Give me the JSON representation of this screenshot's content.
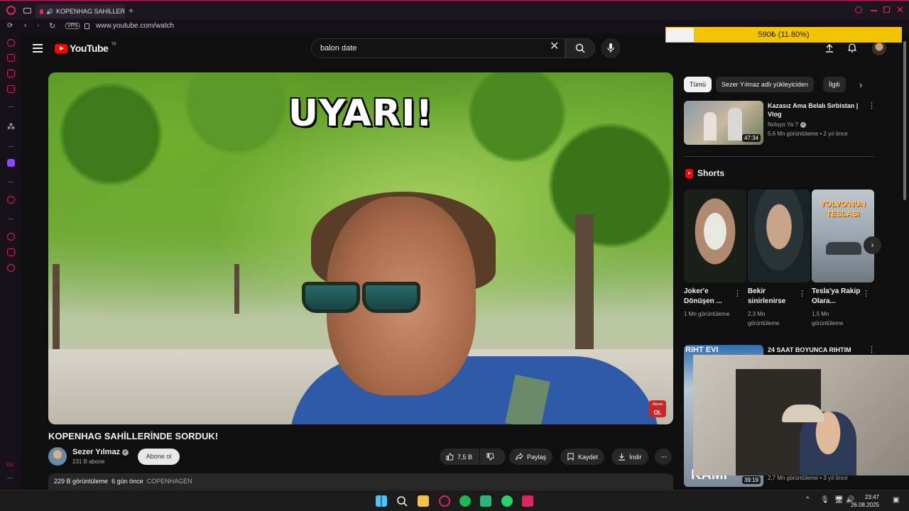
{
  "browser": {
    "tab_title": "KOPENHAG SAHİLLER",
    "vpn_label": "VPN",
    "url": "www.youtube.com/watch"
  },
  "header": {
    "logo_text": "YouTube",
    "logo_region": "TR",
    "search_value": "balon date"
  },
  "donation": {
    "label": "590₺ (11.80%)",
    "progress_percent": 11.8
  },
  "video": {
    "overlay_text": "UYARI!",
    "subscribe_badge_line1": "Abone",
    "subscribe_badge_line2": "OL",
    "title": "KOPENHAG SAHİLLERİNDE SORDUK!",
    "channel_name": "Sezer Yılmaz",
    "subscribers": "231 B abone",
    "subscribe_label": "Abone ol",
    "likes": "7,5 B",
    "share_label": "Paylaş",
    "save_label": "Kaydet",
    "download_label": "İndir",
    "description_views": "229 B görüntüleme",
    "description_date": "6 gün önce",
    "description_tag": "COPENHAGEN"
  },
  "chips": [
    {
      "label": "Tümü"
    },
    {
      "label": "Sezer Yılmaz adlı yükleyiciden"
    },
    {
      "label": "İlgili"
    }
  ],
  "recommendations": [
    {
      "title": "Kazasız Ama Belalı Sırbistan | Vlog",
      "channel": "Noluyo Ya ?",
      "meta": "5,6 Mn görüntüleme • 2 yıl önce",
      "duration": "47:34"
    },
    {
      "title": "24 SAAT BOYUNCA RIHTIM",
      "thumb_text": "RIHT EVI",
      "meta": "2,7 Mn görüntüleme • 3 yıl önce",
      "duration": "39:19",
      "thumb_text_bottom": "KAMP"
    }
  ],
  "shorts": {
    "title": "Shorts",
    "items": [
      {
        "title": "Joker'e Dönüşen ...",
        "views": "1 Mn görüntüleme"
      },
      {
        "title": "Bekir sinirlenirse",
        "views": "2,3 Mn görüntüleme"
      },
      {
        "title": "Tesla'ya Rakip Olara...",
        "views": "1,5 Mn görüntüleme",
        "thumb_text": "VOLVO'NUN TESLASI"
      }
    ]
  },
  "taskbar": {
    "time": "23:47",
    "date": "26.08.2025"
  },
  "colors": {
    "accent_red": "#ff0000",
    "opera_accent": "#d1245a",
    "donation_yellow": "#f5c400"
  }
}
